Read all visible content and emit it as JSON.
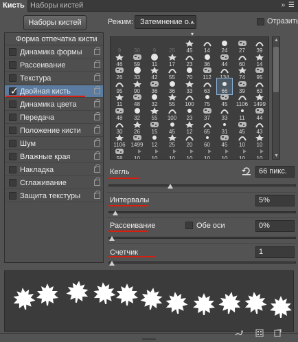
{
  "tabs": [
    {
      "label": "Кисть",
      "active": true
    },
    {
      "label": "Наборы кистей",
      "active": false
    }
  ],
  "toolbar": {
    "presets_button": "Наборы кистей",
    "mode_label": "Режим:",
    "mode_value": "Затемнение о...",
    "flip_label": "Отразить"
  },
  "left_panel": {
    "header": "Форма отпечатка кисти",
    "items": [
      {
        "label": "Динамика формы",
        "checked": false
      },
      {
        "label": "Рассеивание",
        "checked": false
      },
      {
        "label": "Текстура",
        "checked": false
      },
      {
        "label": "Двойная кисть",
        "checked": true,
        "selected": true
      },
      {
        "label": "Динамика цвета",
        "checked": false
      },
      {
        "label": "Передача",
        "checked": false
      },
      {
        "label": "Положение кисти",
        "checked": false
      },
      {
        "label": "Шум",
        "checked": false
      },
      {
        "label": "Влажные края",
        "checked": false
      },
      {
        "label": "Накладка",
        "checked": false
      },
      {
        "label": "Сглаживание",
        "checked": false
      },
      {
        "label": "Защита текстуры",
        "checked": false
      }
    ]
  },
  "brush_grid": {
    "rows": [
      [
        "9",
        "30",
        "9",
        "25",
        "45",
        "14",
        "24",
        "27",
        "39"
      ],
      [
        "46",
        "59",
        "11",
        "17",
        "23",
        "36",
        "44",
        "60",
        "14"
      ],
      [
        "26",
        "33",
        "42",
        "55",
        "70",
        "112",
        "134",
        "74",
        "95"
      ],
      [
        "95",
        "90",
        "36",
        "36",
        "33",
        "63",
        "66",
        "39",
        "63"
      ],
      [
        "11",
        "48",
        "32",
        "55",
        "100",
        "75",
        "45",
        "1106",
        "1499"
      ],
      [
        "48",
        "32",
        "55",
        "100",
        "23",
        "37",
        "33",
        "11",
        "44"
      ],
      [
        "30",
        "26",
        "15",
        "45",
        "12",
        "65",
        "31",
        "45",
        "43"
      ],
      [
        "1106",
        "1499",
        "12",
        "25",
        "20",
        "60",
        "45",
        "10",
        "10"
      ],
      [
        "58",
        "10",
        "10",
        "10",
        "10",
        "10",
        "10",
        "10",
        "10"
      ]
    ],
    "selected": "66"
  },
  "controls": {
    "size_label": "Кегль",
    "size_value": "66 пикс.",
    "spacing_label": "Интервалы",
    "spacing_value": "5%",
    "scatter_label": "Рассеивание",
    "both_axes_label": "Обе оси",
    "scatter_value": "0%",
    "count_label": "Счетчик",
    "count_value": "1",
    "size_slider": 0.32,
    "spacing_slider": 0.02,
    "scatter_slider": 0.0,
    "count_slider": 0.0
  },
  "colors": {
    "accent_underline": "#d81f0f",
    "selection": "#5b7ca0",
    "panel_bg": "#535353"
  },
  "icons": [
    "reset-icon",
    "brush-preview-icon",
    "grid-icon",
    "new-brush-icon",
    "panel-menu-icon"
  ]
}
